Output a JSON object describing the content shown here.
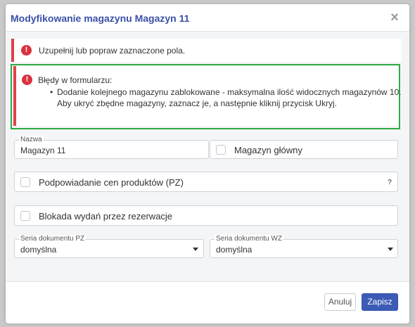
{
  "modal": {
    "title": "Modyfikowanie magazynu Magazyn 11",
    "close_icon": "×"
  },
  "alerts": {
    "general": "Uzupełnij lub popraw zaznaczone pola.",
    "errors_title": "Błędy w formularzu:",
    "errors": [
      "Dodanie kolejnego magazynu zablokowane - maksymalna ilość widocznych magazynów 10.",
      "Aby ukryć zbędne magazyny, zaznacz je, a następnie kliknij przycisk Ukryj."
    ]
  },
  "form": {
    "name_label": "Nazwa",
    "name_value": "Magazyn 11",
    "main_warehouse_label": "Magazyn główny",
    "main_warehouse_checked": false,
    "price_suggest_label": "Podpowiadanie cen produktów (PZ)",
    "price_suggest_checked": false,
    "help_mark": "?",
    "block_label": "Blokada wydań przez rezerwacje",
    "block_checked": false,
    "series_pz_label": "Seria dokumentu PZ",
    "series_pz_value": "domyślna",
    "series_wz_label": "Seria dokumentu WZ",
    "series_wz_value": "domyślna"
  },
  "footer": {
    "cancel_label": "Anuluj",
    "save_label": "Zapisz"
  },
  "colors": {
    "title": "#3b50a8",
    "error": "#e2404a",
    "highlight_border": "#2fa945",
    "primary_button": "#3b5bb5"
  }
}
